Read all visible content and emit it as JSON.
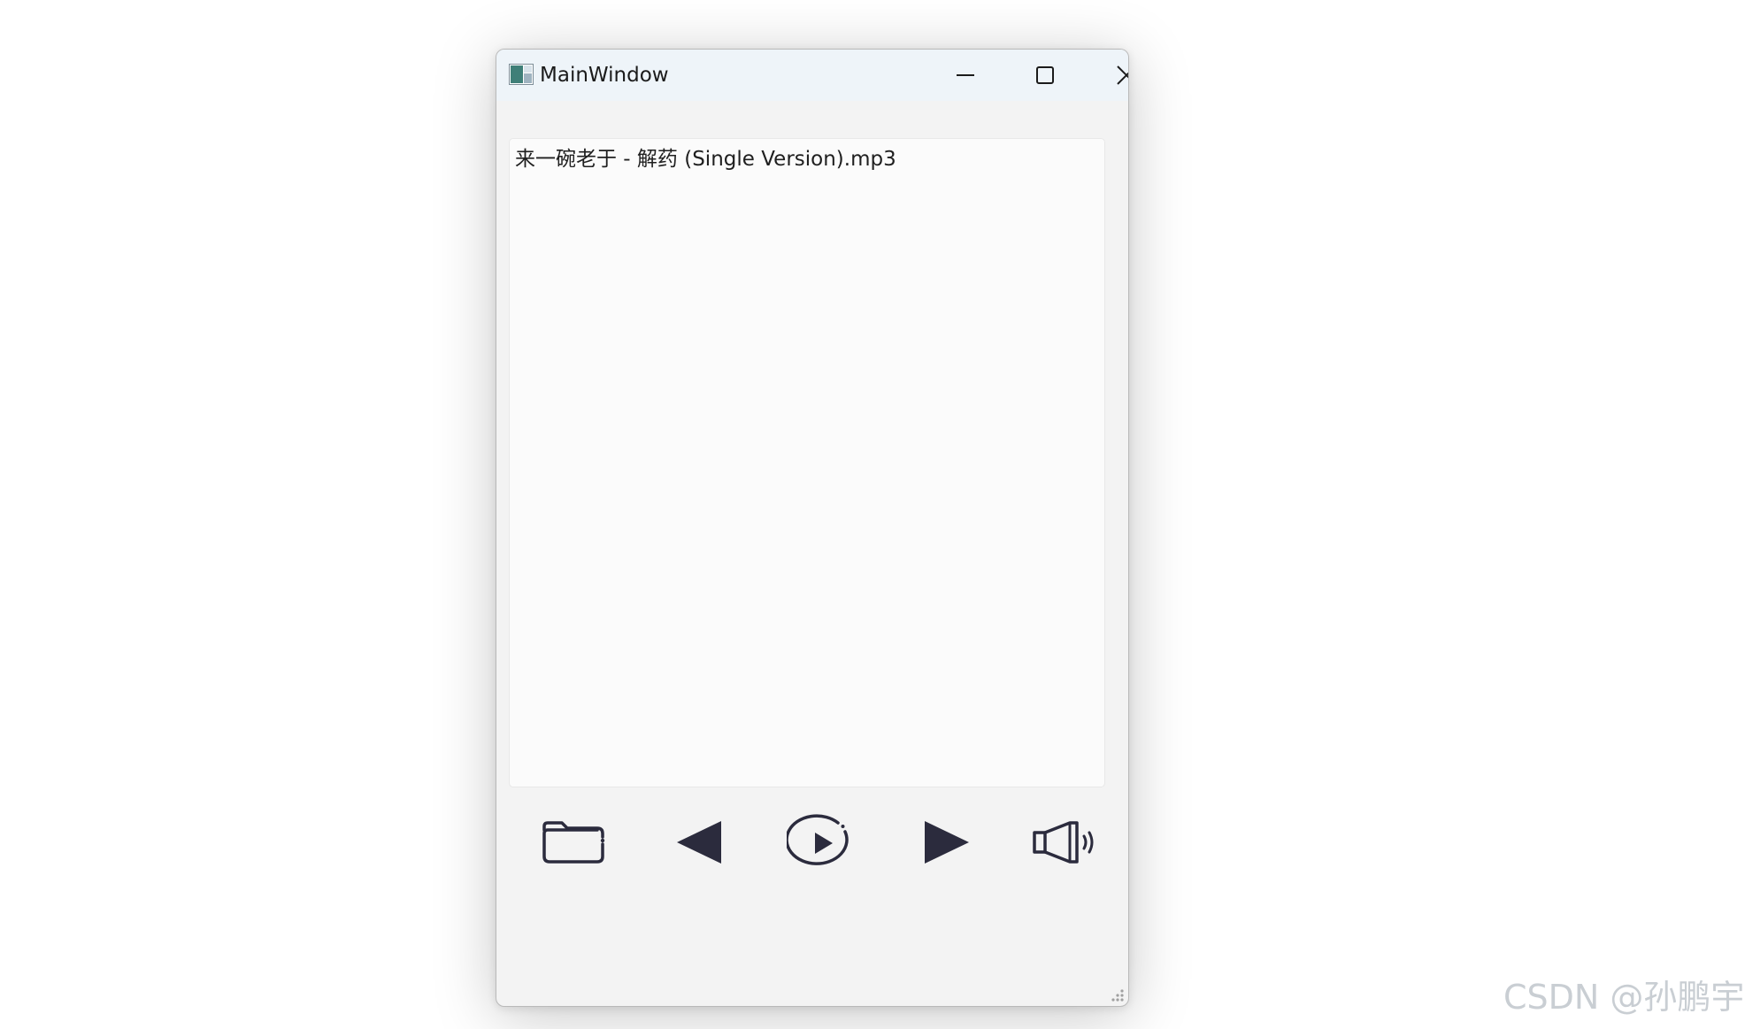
{
  "window": {
    "title": "MainWindow",
    "icon": "app-window-icon",
    "caption_buttons": [
      "minimize-icon",
      "maximize-icon",
      "close-icon"
    ]
  },
  "playlist": {
    "items": [
      {
        "label": "来一碗老于 - 解药 (Single Version).mp3"
      }
    ]
  },
  "controls": {
    "icons": [
      "folder-icon",
      "previous-icon",
      "play-icon",
      "next-icon",
      "volume-icon"
    ],
    "icon_color": "#2b2b3d"
  },
  "watermark": {
    "text": "CSDN @孙鹏宇."
  },
  "colors": {
    "titlebar": "#eef4f9",
    "window_bg": "#f3f3f3",
    "list_bg": "#fbfbfb",
    "icon_dark": "#2b2b3d"
  }
}
